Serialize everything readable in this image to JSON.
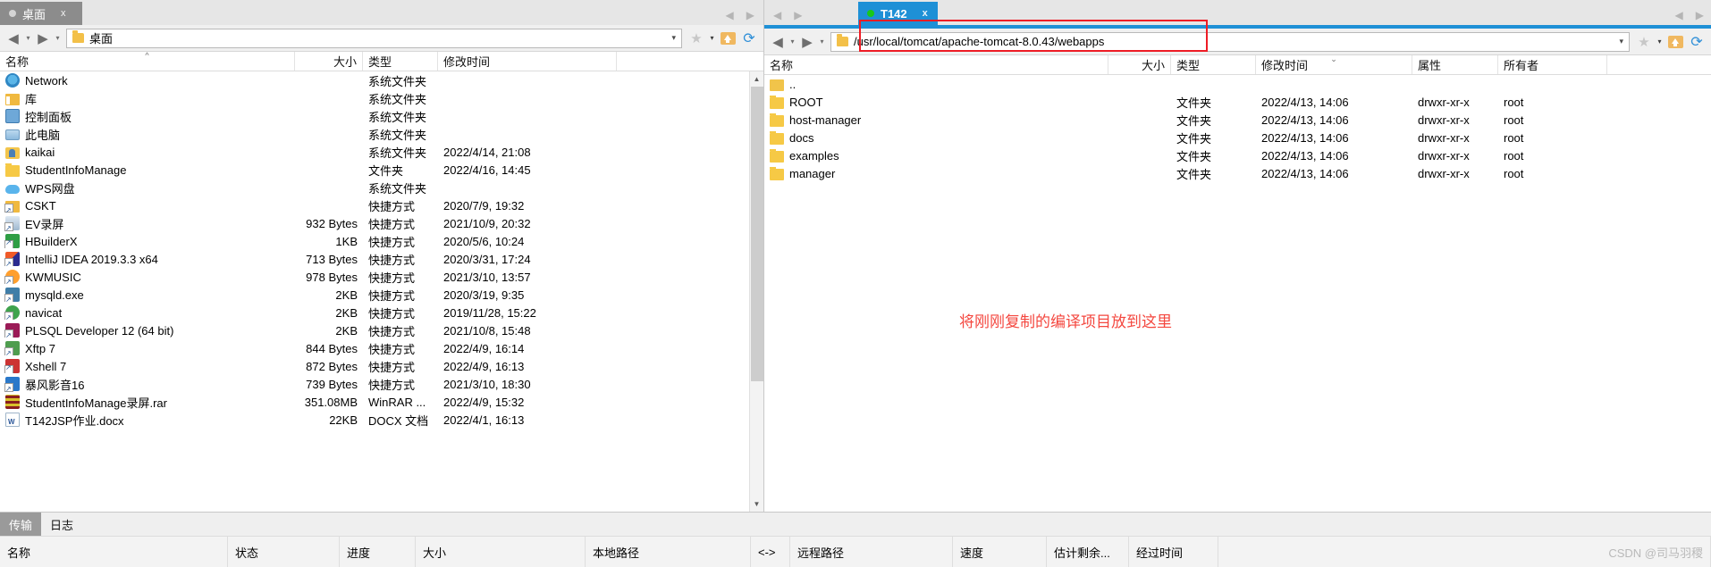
{
  "left_pane": {
    "tab": {
      "label": "桌面",
      "close": "x"
    },
    "address": {
      "value": "桌面"
    },
    "nav": {
      "back": "◀",
      "forward": "▶",
      "caret": "▾"
    },
    "toolbar": {
      "star": "★",
      "star_caret": "▾",
      "home": "home-icon",
      "refresh": "⟳"
    },
    "columns": [
      {
        "key": "name",
        "label": "名称"
      },
      {
        "key": "size",
        "label": "大小"
      },
      {
        "key": "type",
        "label": "类型"
      },
      {
        "key": "mtime",
        "label": "修改时间"
      }
    ],
    "rows": [
      {
        "icon": "network-icon",
        "name": "Network",
        "size": "",
        "type": "系统文件夹",
        "mtime": ""
      },
      {
        "icon": "library-icon",
        "name": "库",
        "size": "",
        "type": "系统文件夹",
        "mtime": ""
      },
      {
        "icon": "control-panel-icon",
        "name": "控制面板",
        "size": "",
        "type": "系统文件夹",
        "mtime": ""
      },
      {
        "icon": "this-pc-icon",
        "name": "此电脑",
        "size": "",
        "type": "系统文件夹",
        "mtime": ""
      },
      {
        "icon": "user-folder-icon",
        "name": "kaikai",
        "size": "",
        "type": "系统文件夹",
        "mtime": "2022/4/14, 21:08"
      },
      {
        "icon": "folder-icon",
        "name": "StudentInfoManage",
        "size": "",
        "type": "文件夹",
        "mtime": "2022/4/16, 14:45"
      },
      {
        "icon": "wps-cloud-icon",
        "name": "WPS网盘",
        "size": "",
        "type": "系统文件夹",
        "mtime": ""
      },
      {
        "icon": "cskt-icon",
        "name": "CSKT",
        "size": "",
        "type": "快捷方式",
        "mtime": "2020/7/9, 19:32"
      },
      {
        "icon": "ev-recorder-icon",
        "name": "EV录屏",
        "size": "932 Bytes",
        "type": "快捷方式",
        "mtime": "2021/10/9, 20:32"
      },
      {
        "icon": "hbuilderx-icon",
        "name": "HBuilderX",
        "size": "1KB",
        "type": "快捷方式",
        "mtime": "2020/5/6, 10:24"
      },
      {
        "icon": "intellij-idea-icon",
        "name": "IntelliJ IDEA 2019.3.3 x64",
        "size": "713 Bytes",
        "type": "快捷方式",
        "mtime": "2020/3/31, 17:24"
      },
      {
        "icon": "kwmusic-icon",
        "name": "KWMUSIC",
        "size": "978 Bytes",
        "type": "快捷方式",
        "mtime": "2021/3/10, 13:57"
      },
      {
        "icon": "mysqld-icon",
        "name": "mysqld.exe",
        "size": "2KB",
        "type": "快捷方式",
        "mtime": "2020/3/19, 9:35"
      },
      {
        "icon": "navicat-icon",
        "name": "navicat",
        "size": "2KB",
        "type": "快捷方式",
        "mtime": "2019/11/28, 15:22"
      },
      {
        "icon": "plsql-icon",
        "name": "PLSQL Developer 12 (64 bit)",
        "size": "2KB",
        "type": "快捷方式",
        "mtime": "2021/10/8, 15:48"
      },
      {
        "icon": "xftp-icon",
        "name": "Xftp 7",
        "size": "844 Bytes",
        "type": "快捷方式",
        "mtime": "2022/4/9, 16:14"
      },
      {
        "icon": "xshell-icon",
        "name": "Xshell 7",
        "size": "872 Bytes",
        "type": "快捷方式",
        "mtime": "2022/4/9, 16:13"
      },
      {
        "icon": "baofeng-icon",
        "name": "暴风影音16",
        "size": "739 Bytes",
        "type": "快捷方式",
        "mtime": "2021/3/10, 18:30"
      },
      {
        "icon": "winrar-icon",
        "name": "StudentInfoManage录屏.rar",
        "size": "351.08MB",
        "type": "WinRAR ...",
        "mtime": "2022/4/9, 15:32"
      },
      {
        "icon": "docx-icon",
        "name": "T142JSP作业.docx",
        "size": "22KB",
        "type": "DOCX 文档",
        "mtime": "2022/4/1, 16:13"
      }
    ]
  },
  "right_pane": {
    "tab": {
      "label": "T142",
      "close": "x"
    },
    "address": {
      "value": "/usr/local/tomcat/apache-tomcat-8.0.43/webapps"
    },
    "nav": {
      "back": "◀",
      "forward": "▶",
      "caret": "▾"
    },
    "toolbar": {
      "star": "★",
      "star_caret": "▾",
      "home": "home-icon",
      "refresh": "⟳"
    },
    "columns": [
      {
        "key": "name",
        "label": "名称"
      },
      {
        "key": "size",
        "label": "大小"
      },
      {
        "key": "type",
        "label": "类型"
      },
      {
        "key": "mtime",
        "label": "修改时间"
      },
      {
        "key": "attr",
        "label": "属性"
      },
      {
        "key": "owner",
        "label": "所有者"
      }
    ],
    "rows": [
      {
        "icon": "folder-up-icon",
        "name": "..",
        "size": "",
        "type": "",
        "mtime": "",
        "attr": "",
        "owner": ""
      },
      {
        "icon": "folder-icon",
        "name": "ROOT",
        "size": "",
        "type": "文件夹",
        "mtime": "2022/4/13, 14:06",
        "attr": "drwxr-xr-x",
        "owner": "root"
      },
      {
        "icon": "folder-icon",
        "name": "host-manager",
        "size": "",
        "type": "文件夹",
        "mtime": "2022/4/13, 14:06",
        "attr": "drwxr-xr-x",
        "owner": "root"
      },
      {
        "icon": "folder-icon",
        "name": "docs",
        "size": "",
        "type": "文件夹",
        "mtime": "2022/4/13, 14:06",
        "attr": "drwxr-xr-x",
        "owner": "root"
      },
      {
        "icon": "folder-icon",
        "name": "examples",
        "size": "",
        "type": "文件夹",
        "mtime": "2022/4/13, 14:06",
        "attr": "drwxr-xr-x",
        "owner": "root"
      },
      {
        "icon": "folder-icon",
        "name": "manager",
        "size": "",
        "type": "文件夹",
        "mtime": "2022/4/13, 14:06",
        "attr": "drwxr-xr-x",
        "owner": "root"
      }
    ],
    "annotation": {
      "text": "将刚刚复制的编译项目放到这里",
      "color": "#f4473f"
    }
  },
  "bottom": {
    "tabs": [
      {
        "label": "传输",
        "active": true
      },
      {
        "label": "日志",
        "active": false
      }
    ],
    "columns": [
      {
        "key": "name",
        "label": "名称"
      },
      {
        "key": "status",
        "label": "状态"
      },
      {
        "key": "progress",
        "label": "进度"
      },
      {
        "key": "size",
        "label": "大小"
      },
      {
        "key": "localpath",
        "label": "本地路径"
      },
      {
        "key": "dir",
        "label": "<->"
      },
      {
        "key": "remotepath",
        "label": "远程路径"
      },
      {
        "key": "speed",
        "label": "速度"
      },
      {
        "key": "eta",
        "label": "估计剩余..."
      },
      {
        "key": "elapsed",
        "label": "经过时间"
      }
    ],
    "watermark": "CSDN @司马羽稷"
  },
  "theme": {
    "accent": "#1e90d6",
    "tab_inactive": "#8c8c8c",
    "highlight_red": "#ee1c25"
  }
}
